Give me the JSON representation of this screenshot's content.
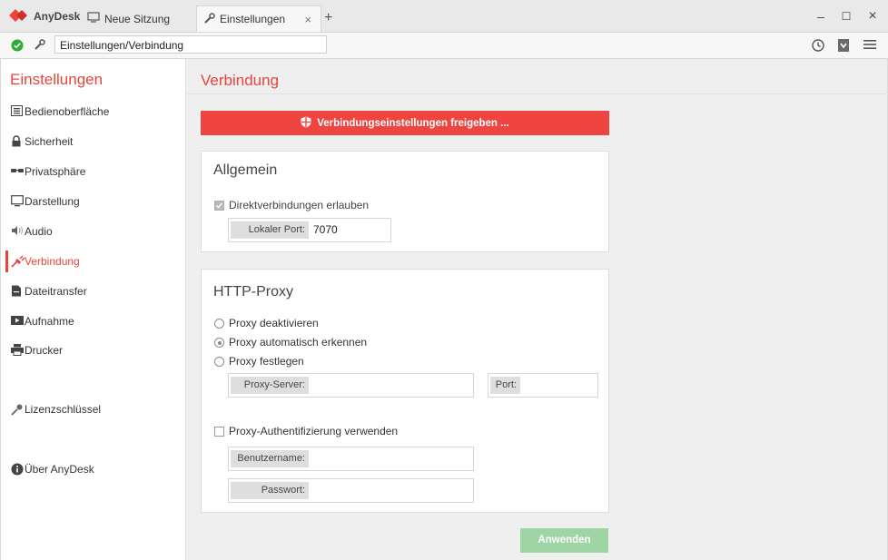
{
  "titlebar": {
    "app_name": "AnyDesk",
    "tabs": [
      {
        "label": "Neue Sitzung"
      },
      {
        "label": "Einstellungen"
      }
    ],
    "tab_close": "×",
    "new_tab": "+",
    "minimize": "‒",
    "maximize": "☐",
    "close": "×"
  },
  "addressbar": {
    "address": "Einstellungen/Verbindung"
  },
  "sidebar": {
    "title": "Einstellungen",
    "items": [
      {
        "label": "Bedienoberfläche",
        "icon": "menu-icon"
      },
      {
        "label": "Sicherheit",
        "icon": "lock-icon"
      },
      {
        "label": "Privatsphäre",
        "icon": "glasses-icon"
      },
      {
        "label": "Darstellung",
        "icon": "monitor-icon"
      },
      {
        "label": "Audio",
        "icon": "speaker-icon"
      },
      {
        "label": "Verbindung",
        "icon": "plug-icon",
        "active": true
      },
      {
        "label": "Dateitransfer",
        "icon": "file-icon"
      },
      {
        "label": "Aufnahme",
        "icon": "video-icon"
      },
      {
        "label": "Drucker",
        "icon": "printer-icon"
      },
      {
        "label": "Lizenzschlüssel",
        "icon": "key-icon"
      },
      {
        "label": "Über AnyDesk",
        "icon": "info-icon"
      }
    ]
  },
  "main": {
    "title": "Verbindung",
    "unlock_button": "Verbindungseinstellungen freigeben ...",
    "general": {
      "heading": "Allgemein",
      "direct_connections_label": "Direktverbindungen erlauben",
      "direct_connections_checked": true,
      "local_port_label": "Lokaler Port:",
      "local_port_value": "7070"
    },
    "proxy": {
      "heading": "HTTP-Proxy",
      "options": [
        {
          "label": "Proxy deaktivieren",
          "selected": false
        },
        {
          "label": "Proxy automatisch erkennen",
          "selected": true
        },
        {
          "label": "Proxy festlegen",
          "selected": false
        }
      ],
      "server_label": "Proxy-Server:",
      "server_value": "",
      "port_label": "Port:",
      "port_value": "",
      "auth_label": "Proxy-Authentifizierung verwenden",
      "auth_checked": false,
      "username_label": "Benutzername:",
      "username_value": "",
      "password_label": "Passwort:",
      "password_value": ""
    },
    "apply_button": "Anwenden"
  },
  "colors": {
    "accent": "#e9443b",
    "banner": "#ee4540",
    "apply_disabled": "#9fd4a4",
    "status_ok": "#2eaa3a"
  }
}
